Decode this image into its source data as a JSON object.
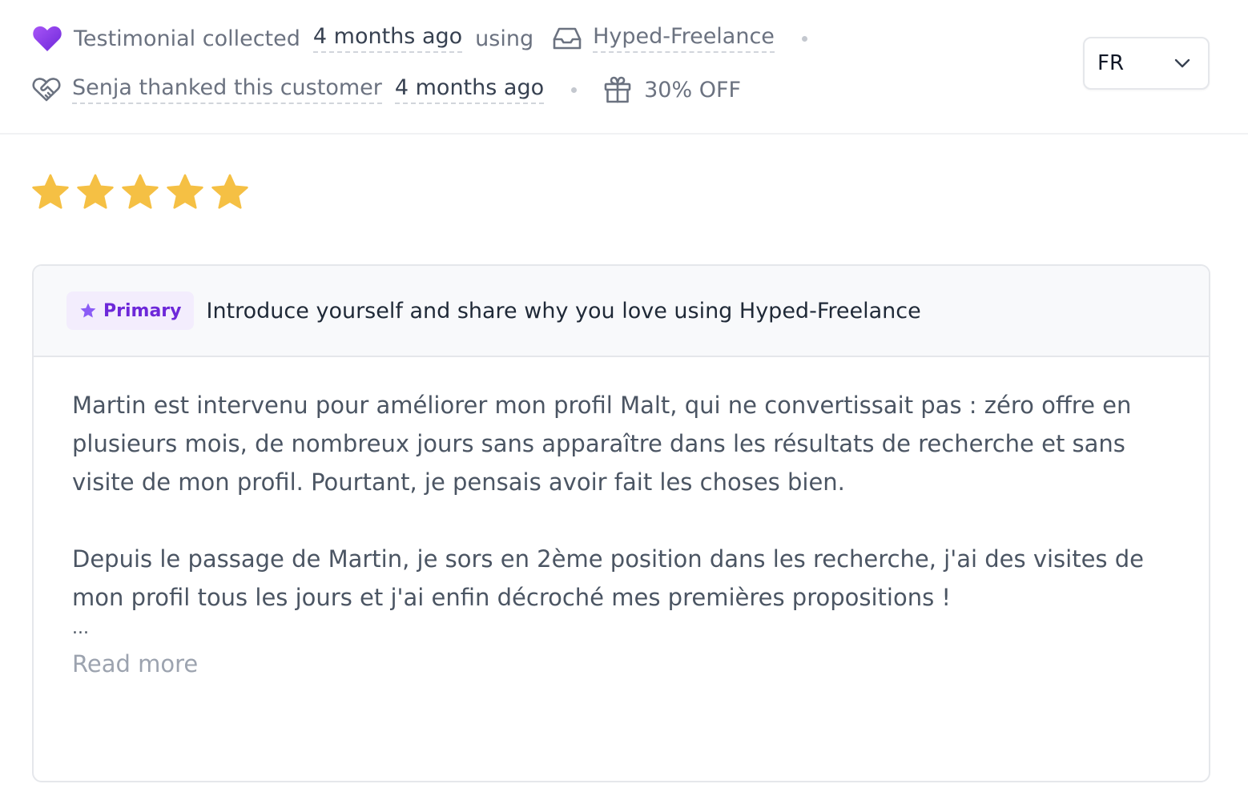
{
  "meta": {
    "row1": {
      "collected_label": "Testimonial collected",
      "collected_time": "4 months ago",
      "using_label": "using",
      "source_name": "Hyped-Freelance"
    },
    "row2": {
      "thanked_label": "Senja thanked this customer",
      "thanked_time": "4 months ago",
      "discount": "30% OFF"
    },
    "icons": {
      "collected": "heart-icon",
      "source": "inbox-icon",
      "thanked": "heart-handshake-icon",
      "discount": "gift-icon",
      "dropdown": "chevron-down-icon"
    }
  },
  "language_select": {
    "value": "FR"
  },
  "rating": {
    "stars": 5,
    "max": 5,
    "color": "#f5c044"
  },
  "card": {
    "badge_label": "Primary",
    "question": "Introduce yourself and share why you love using Hyped-Freelance",
    "paragraphs": [
      "Martin est intervenu pour améliorer mon profil Malt, qui ne convertissait pas : zéro offre en plusieurs mois, de nombreux jours sans apparaître dans les résultats de recherche et sans visite de mon profil. Pourtant, je pensais avoir fait les choses bien.",
      "Depuis le passage de Martin, je sors en 2ème position dans les recherche, j'ai des visites de mon profil tous les jours et j'ai enfin décroché mes premières propositions !"
    ],
    "ellipsis": "...",
    "read_more": "Read more"
  },
  "colors": {
    "accent_purple": "#7c3aed",
    "badge_bg": "#f3edfd",
    "star": "#f5c044"
  }
}
